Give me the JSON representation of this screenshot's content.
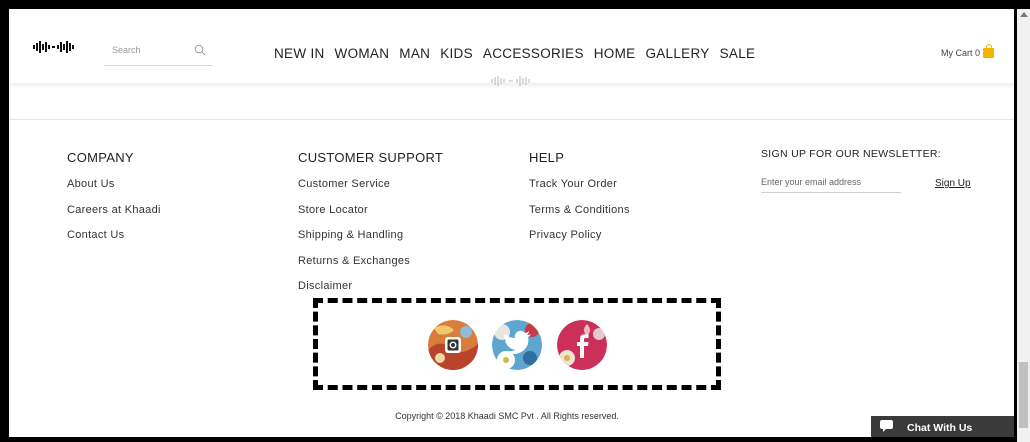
{
  "header": {
    "search_placeholder": "Search",
    "nav": [
      "NEW IN",
      "WOMAN",
      "MAN",
      "KIDS",
      "ACCESSORIES",
      "HOME",
      "GALLERY",
      "SALE"
    ],
    "cart_label": "My Cart 0"
  },
  "footer": {
    "company": {
      "title": "COMPANY",
      "links": [
        "About Us",
        "Careers at Khaadi",
        "Contact Us"
      ]
    },
    "support": {
      "title": "CUSTOMER SUPPORT",
      "links": [
        "Customer Service",
        "Store Locator",
        "Shipping & Handling",
        "Returns & Exchanges",
        "Disclaimer"
      ]
    },
    "help": {
      "title": "HELP",
      "links": [
        "Track Your Order",
        "Terms & Conditions",
        "Privacy Policy"
      ]
    },
    "newsletter": {
      "title": "SIGN UP FOR OUR NEWSLETTER:",
      "email_placeholder": "Enter your email address",
      "signup_label": "Sign Up"
    },
    "social": [
      "instagram-icon",
      "twitter-icon",
      "facebook-icon"
    ],
    "copyright": "Copyright © 2018 Khaadi SMC Pvt . All Rights reserved."
  },
  "chat": {
    "label": "Chat With Us"
  },
  "colors": {
    "accent_cart": "#f5b400",
    "instagram_bg": "#d97e3a",
    "twitter_bg": "#5ea5cf",
    "facebook_bg": "#cc2f5a",
    "chat_bg": "#3a3a3a"
  }
}
